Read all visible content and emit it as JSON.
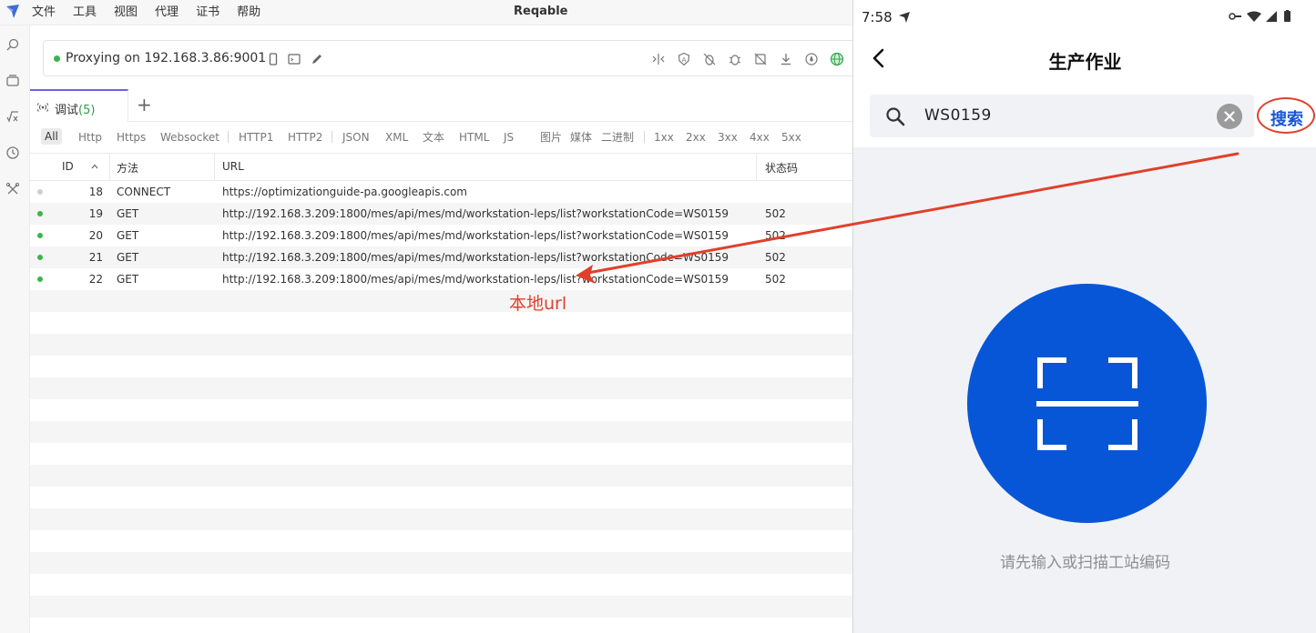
{
  "app": {
    "title": "Reqable",
    "menu": [
      "文件",
      "工具",
      "视图",
      "代理",
      "证书",
      "帮助"
    ]
  },
  "proxy": {
    "status_text": "Proxying on 192.168.3.86:9001",
    "status_color": "#3bb54a"
  },
  "tabs": {
    "active_label": "调试",
    "active_count": "(5)",
    "add_label": "+"
  },
  "filters": {
    "all": "All",
    "items": [
      "Http",
      "Https",
      "Websocket",
      "HTTP1",
      "HTTP2",
      "JSON",
      "XML",
      "文本",
      "HTML",
      "JS",
      "图片",
      "媒体",
      "二进制",
      "1xx",
      "2xx",
      "3xx",
      "4xx",
      "5xx"
    ]
  },
  "table": {
    "columns": {
      "id": "ID",
      "method": "方法",
      "url": "URL",
      "status": "状态码"
    },
    "rows": [
      {
        "id": "18",
        "method": "CONNECT",
        "url": "https://optimizationguide-pa.googleapis.com",
        "status": "",
        "dot": "#cfcfcf"
      },
      {
        "id": "19",
        "method": "GET",
        "url": "http://192.168.3.209:1800/mes/api/mes/md/workstation-leps/list?workstationCode=WS0159",
        "status": "502",
        "dot": "#3bb54a"
      },
      {
        "id": "20",
        "method": "GET",
        "url": "http://192.168.3.209:1800/mes/api/mes/md/workstation-leps/list?workstationCode=WS0159",
        "status": "502",
        "dot": "#3bb54a"
      },
      {
        "id": "21",
        "method": "GET",
        "url": "http://192.168.3.209:1800/mes/api/mes/md/workstation-leps/list?workstationCode=WS0159",
        "status": "502",
        "dot": "#3bb54a"
      },
      {
        "id": "22",
        "method": "GET",
        "url": "http://192.168.3.209:1800/mes/api/mes/md/workstation-leps/list?workstationCode=WS0159",
        "status": "502",
        "dot": "#3bb54a"
      }
    ]
  },
  "annotation": {
    "label": "本地url",
    "color": "#e0402b"
  },
  "phone": {
    "status_time": "7:58",
    "title": "生产作业",
    "search_value": "WS0159",
    "search_button": "搜索",
    "scan_hint": "请先输入或扫描工站编码",
    "accent": "#0756d7"
  }
}
